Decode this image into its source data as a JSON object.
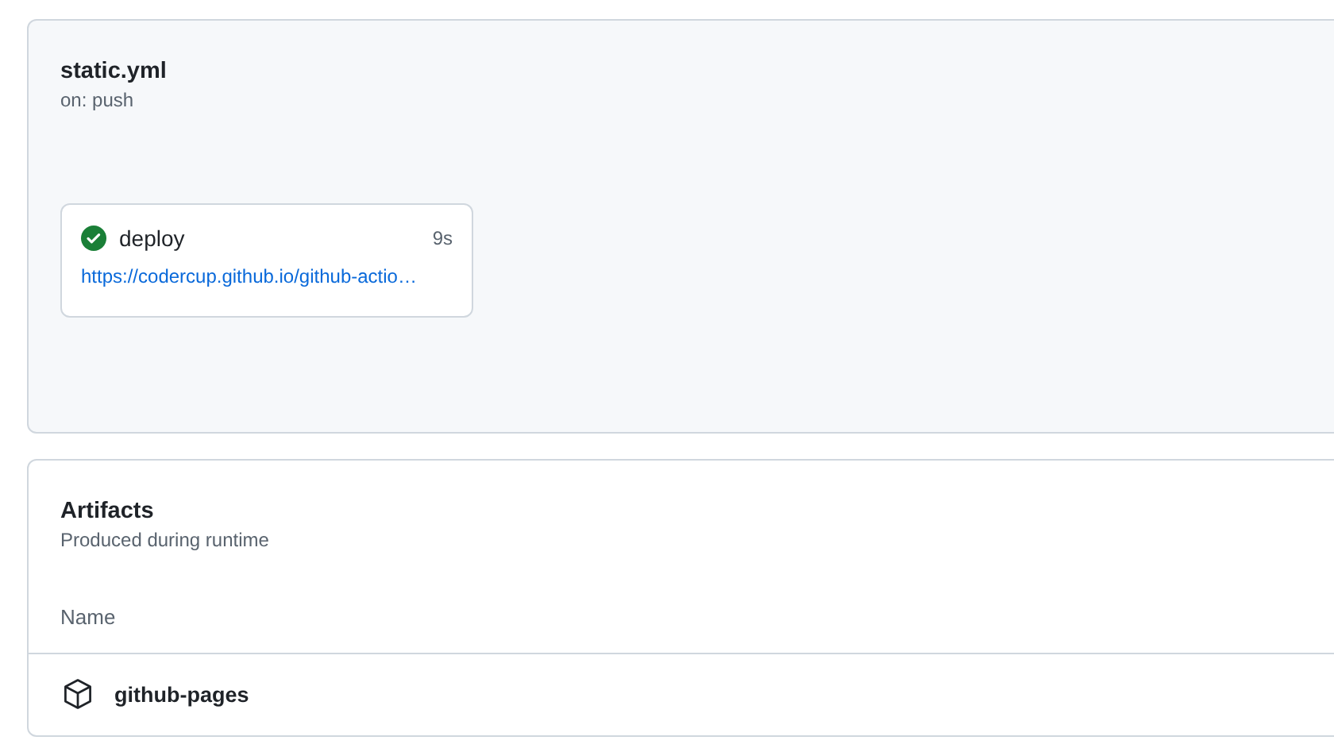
{
  "workflow": {
    "title": "static.yml",
    "trigger": "on: push",
    "jobs": [
      {
        "name": "deploy",
        "succeeded": true,
        "duration": "9s",
        "url": "https://codercup.github.io/github-actio…"
      }
    ]
  },
  "artifacts": {
    "title": "Artifacts",
    "subtitle": "Produced during runtime",
    "columns": [
      "Name"
    ],
    "rows": [
      {
        "name": "github-pages"
      }
    ]
  }
}
